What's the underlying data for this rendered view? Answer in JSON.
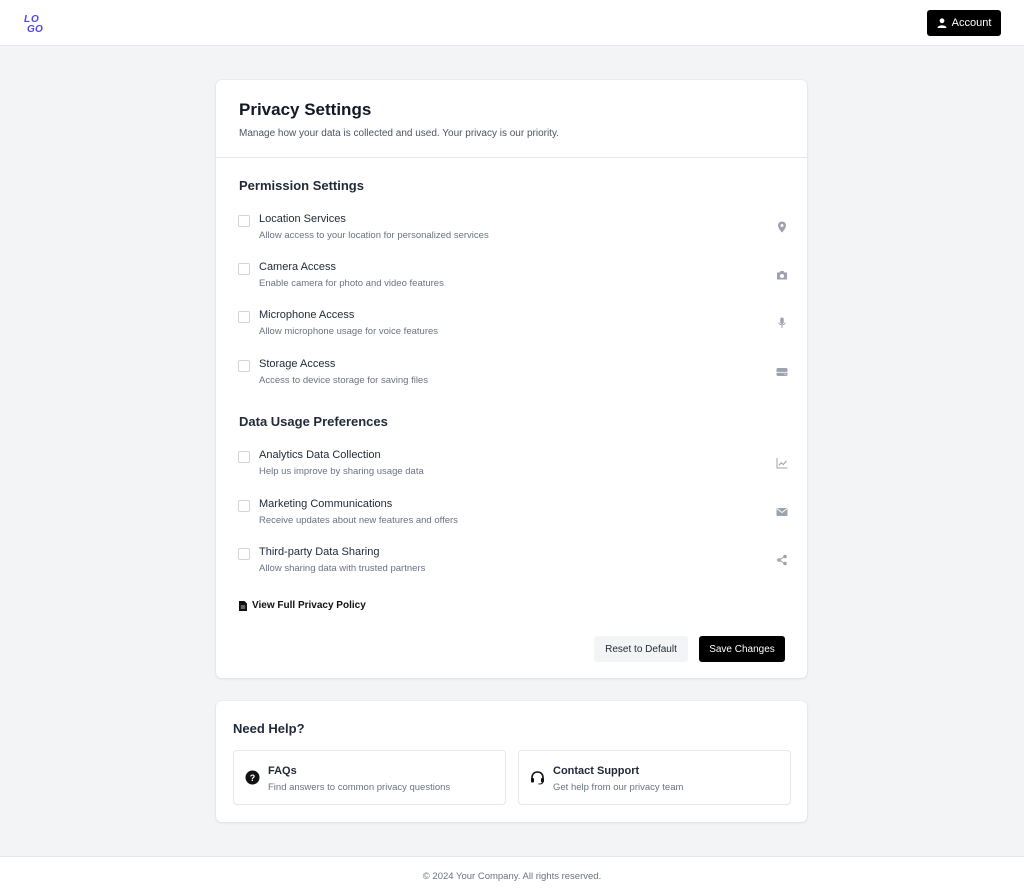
{
  "header": {
    "logo_text": "LOGO",
    "account_label": "Account"
  },
  "privacy": {
    "title": "Privacy Settings",
    "subtitle": "Manage how your data is collected and used. Your privacy is our priority.",
    "permission_title": "Permission Settings",
    "permissions": [
      {
        "label": "Location Services",
        "desc": "Allow access to your location for personalized services",
        "icon": "map-pin-icon",
        "checked": false
      },
      {
        "label": "Camera Access",
        "desc": "Enable camera for photo and video features",
        "icon": "camera-icon",
        "checked": false
      },
      {
        "label": "Microphone Access",
        "desc": "Allow microphone usage for voice features",
        "icon": "microphone-icon",
        "checked": false
      },
      {
        "label": "Storage Access",
        "desc": "Access to device storage for saving files",
        "icon": "hard-drive-icon",
        "checked": false
      }
    ],
    "usage_title": "Data Usage Preferences",
    "usage": [
      {
        "label": "Analytics Data Collection",
        "desc": "Help us improve by sharing usage data",
        "icon": "chart-line-icon",
        "checked": false
      },
      {
        "label": "Marketing Communications",
        "desc": "Receive updates about new features and offers",
        "icon": "envelope-icon",
        "checked": false
      },
      {
        "label": "Third-party Data Sharing",
        "desc": "Allow sharing data with trusted partners",
        "icon": "share-icon",
        "checked": false
      }
    ],
    "policy_link": "View Full Privacy Policy",
    "reset_label": "Reset to Default",
    "save_label": "Save Changes"
  },
  "help": {
    "title": "Need Help?",
    "faq_title": "FAQs",
    "faq_desc": "Find answers to common privacy questions",
    "support_title": "Contact Support",
    "support_desc": "Get help from our privacy team"
  },
  "footer": {
    "text": "© 2024 Your Company. All rights reserved."
  },
  "colors": {
    "accent": "#4f46e5",
    "primary_button": "#000000",
    "icon_gray": "#9ca3af",
    "page_bg": "#f3f4f6"
  }
}
